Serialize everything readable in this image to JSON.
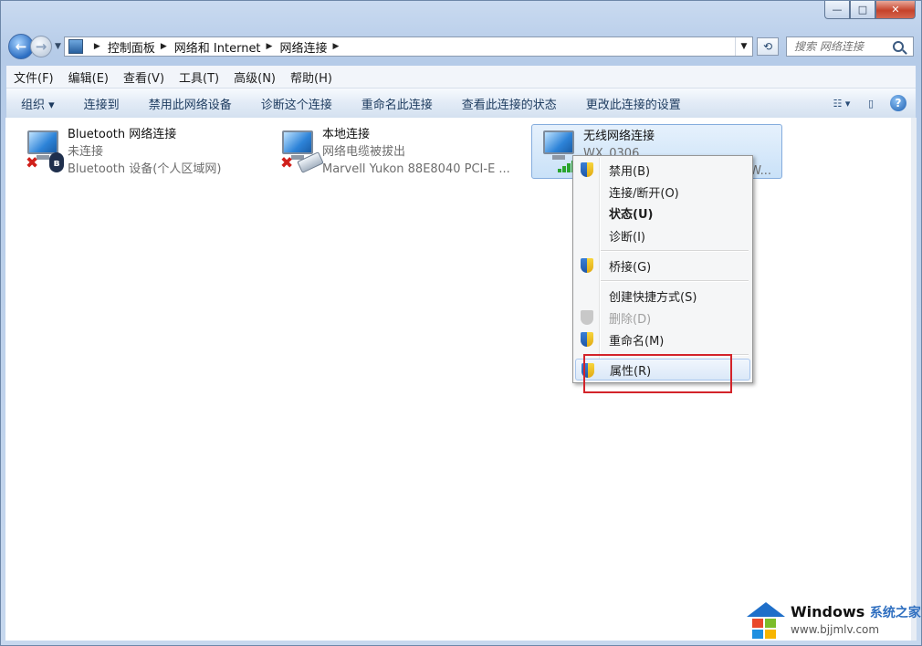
{
  "window": {
    "caption_buttons": {
      "minimize": "—",
      "maximize": "□",
      "close": "✕"
    }
  },
  "navigation": {
    "back_glyph": "←",
    "forward_glyph": "→",
    "breadcrumbs": [
      "控制面板",
      "网络和 Internet",
      "网络连接"
    ],
    "search_placeholder": "搜索 网络连接"
  },
  "menubar": [
    "文件(F)",
    "编辑(E)",
    "查看(V)",
    "工具(T)",
    "高级(N)",
    "帮助(H)"
  ],
  "toolbar": [
    "组织 ▾",
    "连接到",
    "禁用此网络设备",
    "诊断这个连接",
    "重命名此连接",
    "查看此连接的状态",
    "更改此连接的设置"
  ],
  "connections": [
    {
      "name": "Bluetooth 网络连接",
      "status": "未连接",
      "device": "Bluetooth 设备(个人区域网)",
      "badge": "bluetooth",
      "selected": false
    },
    {
      "name": "本地连接",
      "status": "网络电缆被拔出",
      "device": "Marvell Yukon 88E8040 PCI-E ...",
      "badge": "cable",
      "selected": false
    },
    {
      "name": "无线网络连接",
      "status": "WX_0306",
      "device": "W...",
      "badge": "signal",
      "selected": true
    }
  ],
  "context_menu": [
    {
      "label": "禁用(B)",
      "shield": true,
      "bold": false,
      "disabled": false
    },
    {
      "label": "连接/断开(O)",
      "shield": false,
      "bold": false,
      "disabled": false
    },
    {
      "label": "状态(U)",
      "shield": false,
      "bold": true,
      "disabled": false
    },
    {
      "label": "诊断(I)",
      "shield": false,
      "bold": false,
      "disabled": false
    },
    {
      "label": "桥接(G)",
      "shield": true,
      "bold": false,
      "disabled": false
    },
    {
      "label": "创建快捷方式(S)",
      "shield": false,
      "bold": false,
      "disabled": false
    },
    {
      "label": "删除(D)",
      "shield": true,
      "bold": false,
      "disabled": true
    },
    {
      "label": "重命名(M)",
      "shield": true,
      "bold": false,
      "disabled": false
    },
    {
      "label": "属性(R)",
      "shield": true,
      "bold": false,
      "disabled": false,
      "hovered": true
    }
  ],
  "watermark": {
    "title": "Windows",
    "title_cn": "系统之家",
    "url": "www.bjjmlv.com"
  },
  "colors": {
    "highlight_box": "#d3232a",
    "accent": "#1f6fc9"
  }
}
